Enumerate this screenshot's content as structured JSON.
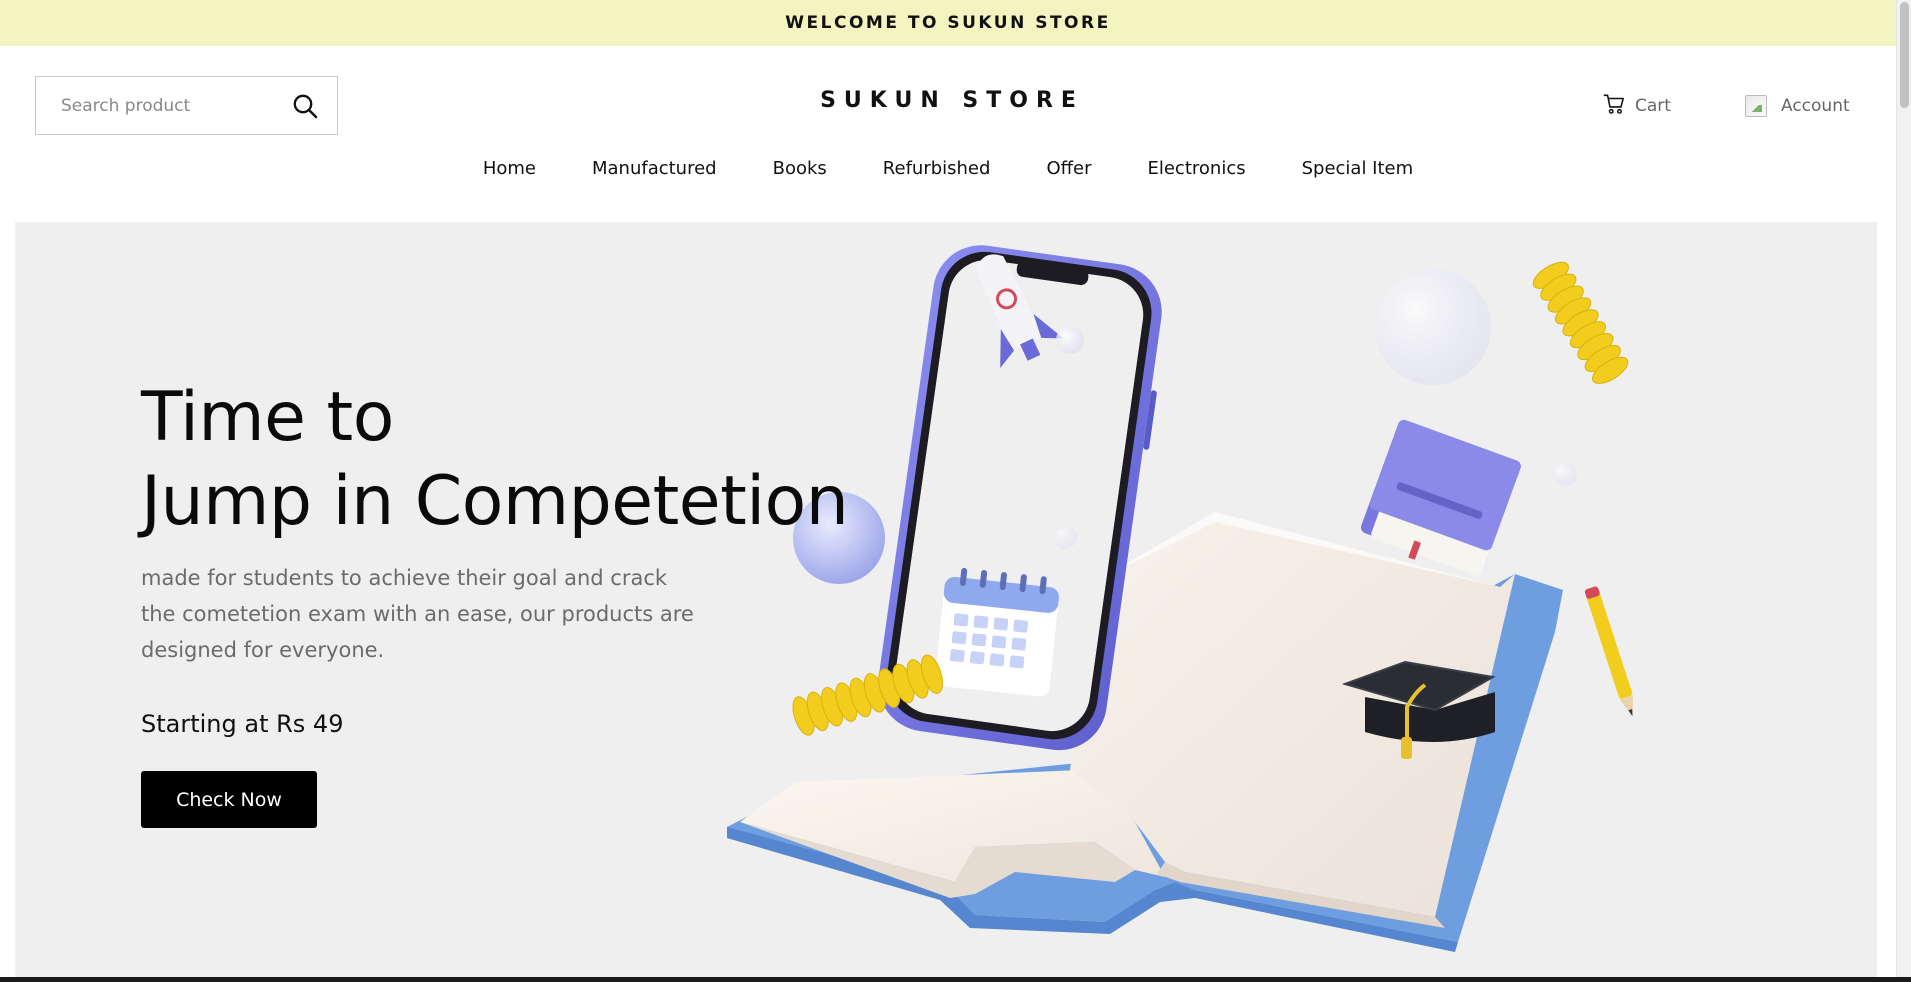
{
  "announcement": "WELCOME TO SUKUN STORE",
  "search": {
    "placeholder": "Search product",
    "icon": "search-icon"
  },
  "brand": "SUKUN STORE",
  "header": {
    "cart_label": "Cart",
    "account_label": "Account",
    "cart_icon": "cart-icon"
  },
  "nav": [
    {
      "label": "Home"
    },
    {
      "label": "Manufactured"
    },
    {
      "label": "Books"
    },
    {
      "label": "Refurbished"
    },
    {
      "label": "Offer"
    },
    {
      "label": "Electronics"
    },
    {
      "label": "Special Item"
    }
  ],
  "hero": {
    "title_line1": "Time to",
    "title_line2": "Jump in Competetion",
    "description": "made for students to achieve their goal and crack the cometetion exam with an ease, our products are designed for everyone.",
    "price_text": "Starting at Rs 49",
    "button_label": "Check Now"
  },
  "colors": {
    "banner_bg": "#f3f4c0",
    "hero_bg": "#efeff0",
    "button_bg": "#000000",
    "accent_purple": "#7b7be0",
    "accent_blue": "#6f9ee0",
    "accent_yellow": "#f2cd1e"
  }
}
